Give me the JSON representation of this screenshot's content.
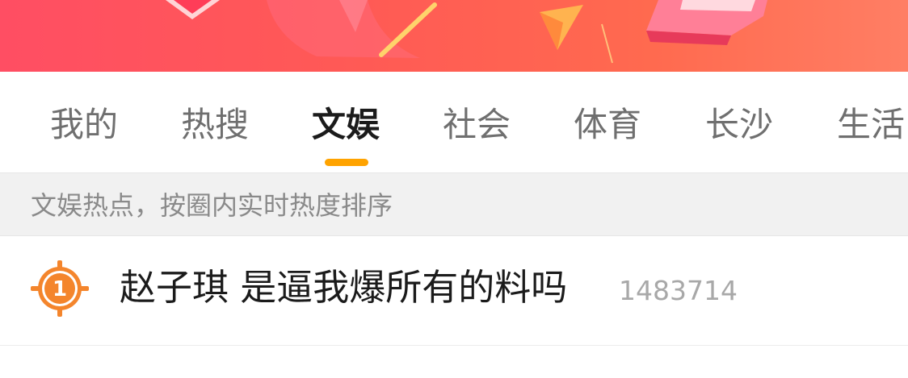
{
  "colors": {
    "banner_gradient": [
      "#ff4e63",
      "#ff7e64"
    ],
    "active_tab_indicator": "#ffa300",
    "rank_badge": "#f4852c"
  },
  "tabs": [
    {
      "label": "我的",
      "active": false
    },
    {
      "label": "热搜",
      "active": false
    },
    {
      "label": "文娱",
      "active": true
    },
    {
      "label": "社会",
      "active": false
    },
    {
      "label": "体育",
      "active": false
    },
    {
      "label": "长沙",
      "active": false
    },
    {
      "label": "生活",
      "active": false
    }
  ],
  "subheader": {
    "text": "文娱热点，按圈内实时热度排序"
  },
  "hot_list": [
    {
      "rank": "1",
      "title": "赵子琪 是逼我爆所有的料吗",
      "heat": "1483714",
      "rank_icon": "orange-circle-rank-icon"
    }
  ],
  "banner": {
    "decoration_icons": [
      "red-envelope-icon",
      "paper-plane-icon",
      "gift-box-icon"
    ]
  }
}
